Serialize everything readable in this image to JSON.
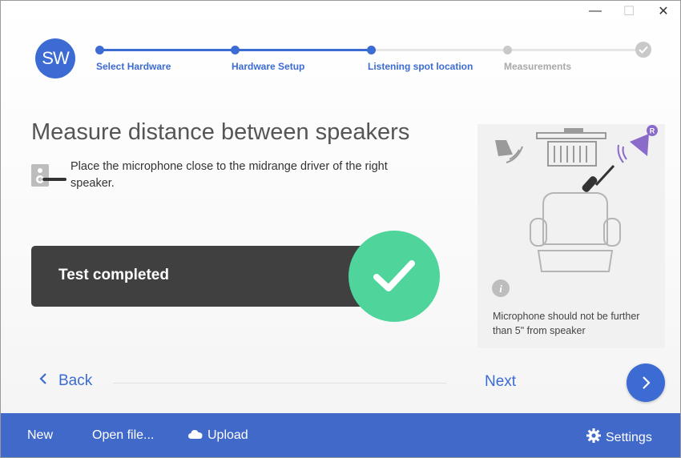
{
  "window": {
    "minimize_glyph": "—",
    "maximize_glyph": "☐",
    "close_glyph": "✕"
  },
  "logo": {
    "text": "SW"
  },
  "stepper": {
    "steps": [
      {
        "label": "Select Hardware",
        "state": "done"
      },
      {
        "label": "Hardware Setup",
        "state": "done"
      },
      {
        "label": "Listening spot location",
        "state": "done"
      },
      {
        "label": "Measurements",
        "state": "todo"
      }
    ],
    "final_icon": "check-icon"
  },
  "main": {
    "title": "Measure distance between speakers",
    "instruction": "Place the microphone close to the midrange driver of the right speaker.",
    "status_text": "Test completed"
  },
  "panel": {
    "note": "Microphone should not be further than 5\" from speaker",
    "speaker_badge": "R"
  },
  "nav": {
    "back_label": "Back",
    "next_label": "Next"
  },
  "toolbar": {
    "new_label": "New",
    "open_label": "Open file...",
    "upload_label": "Upload",
    "settings_label": "Settings"
  },
  "colors": {
    "accent": "#3b6bd3",
    "toolbar": "#4169c9",
    "success": "#4fd59c",
    "status_bar": "#404040",
    "speaker_highlight": "#8a6bc9"
  }
}
